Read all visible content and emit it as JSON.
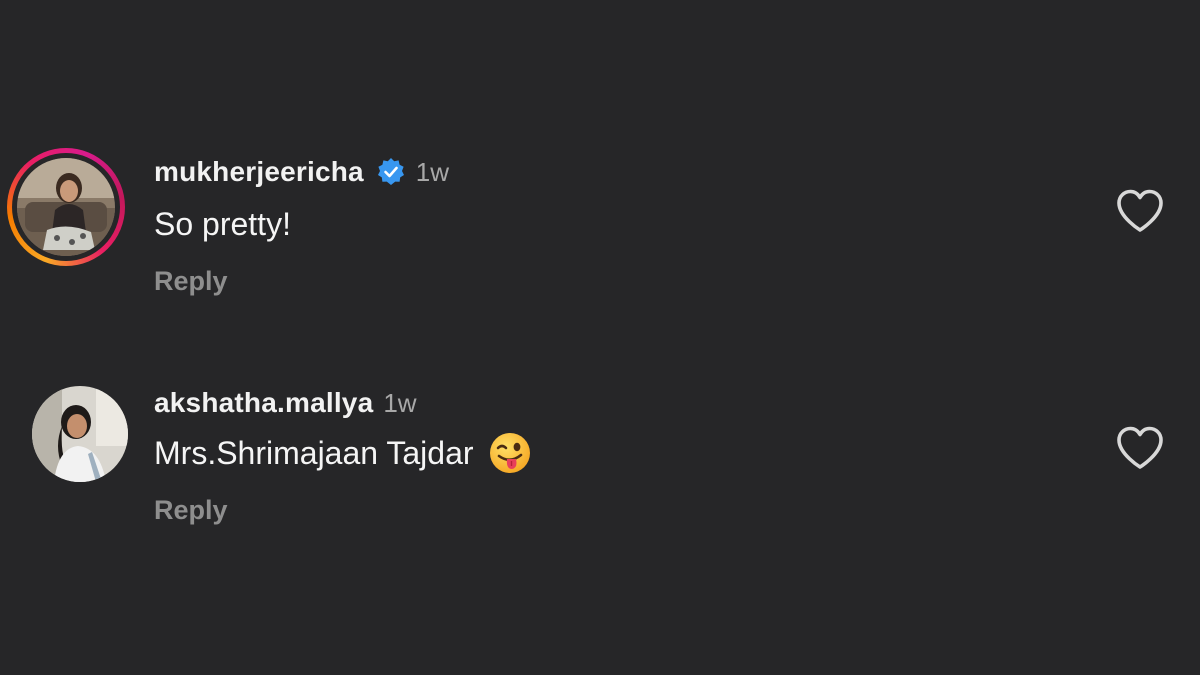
{
  "comments": [
    {
      "username": "mukherjeericha",
      "verified": true,
      "time": "1w",
      "text": "So pretty!",
      "reply_label": "Reply",
      "has_story_ring": true
    },
    {
      "username": "akshatha.mallya",
      "verified": false,
      "time": "1w",
      "text": "Mrs.Shrimajaan Tajdar",
      "emoji": "winking-face-with-tongue",
      "reply_label": "Reply",
      "has_story_ring": false
    }
  ],
  "icons": {
    "like": "heart-outline-icon",
    "verified": "verified-badge-icon"
  },
  "colors": {
    "background": "#262628",
    "verified_blue": "#3897f0",
    "secondary_text": "#a8a8a8"
  }
}
